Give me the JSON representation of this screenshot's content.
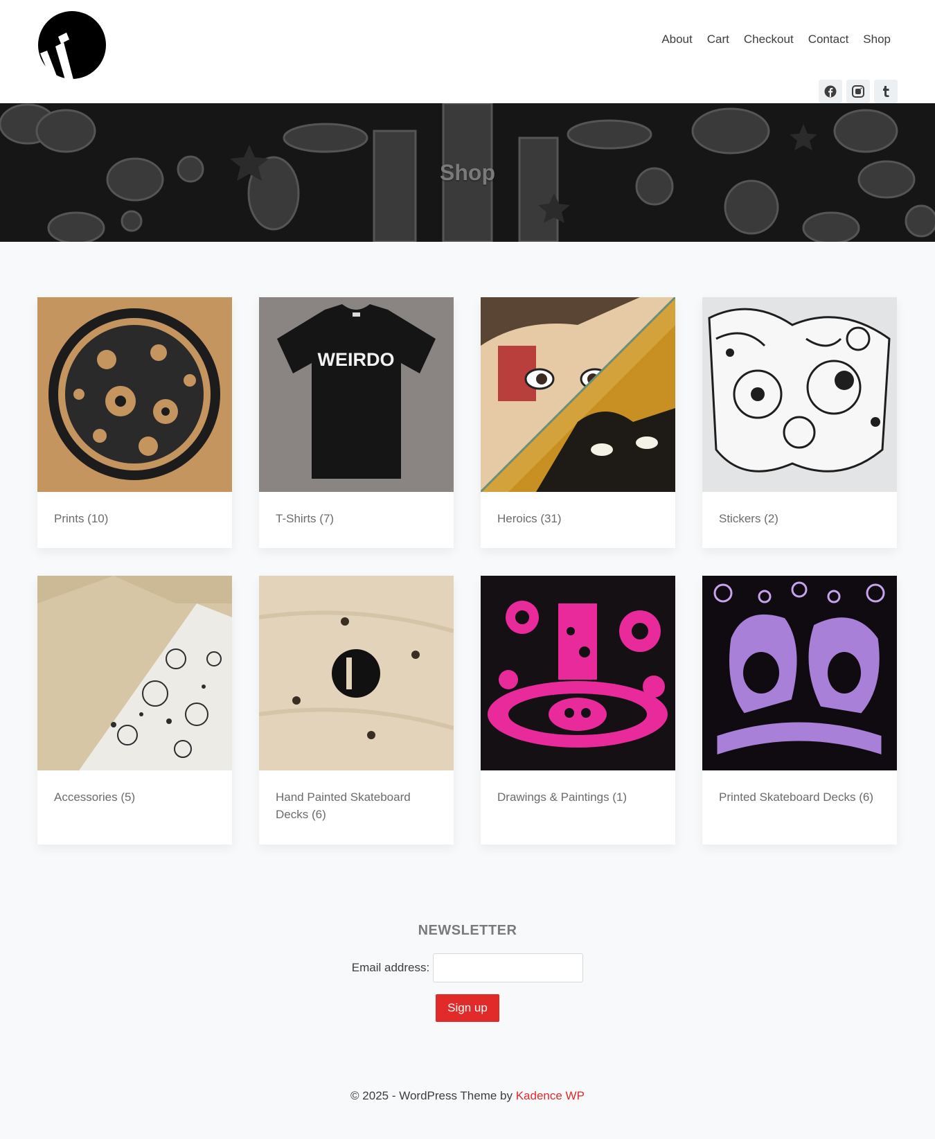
{
  "header": {
    "nav": [
      "About",
      "Cart",
      "Checkout",
      "Contact",
      "Shop"
    ],
    "social": [
      {
        "icon": "facebook-icon"
      },
      {
        "icon": "instagram-icon"
      },
      {
        "icon": "tumblr-icon"
      }
    ]
  },
  "hero": {
    "title": "Shop"
  },
  "categories": [
    {
      "label": "Prints (10)"
    },
    {
      "label": "T-Shirts (7)"
    },
    {
      "label": "Heroics (31)"
    },
    {
      "label": "Stickers (2)"
    },
    {
      "label": "Accessories (5)"
    },
    {
      "label": "Hand Painted Skateboard Decks (6)"
    },
    {
      "label": "Drawings & Paintings (1)"
    },
    {
      "label": "Printed Skateboard Decks (6)"
    }
  ],
  "tshirt_text": "WEIRDO",
  "newsletter": {
    "title": "NEWSLETTER",
    "email_label": "Email address:",
    "email_value": "",
    "button": "Sign up"
  },
  "footer": {
    "text": "© 2025 - WordPress Theme by ",
    "link": "Kadence WP"
  },
  "colors": {
    "accent": "#e12a2a",
    "background": "#f7f9fa",
    "heading": "#7a7a7a"
  }
}
